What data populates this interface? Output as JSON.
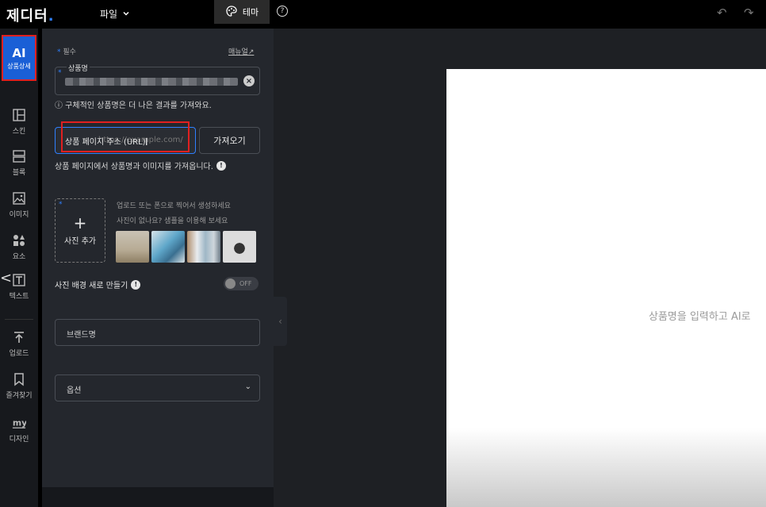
{
  "app": {
    "logo": "제디터",
    "file_menu": "파일",
    "theme_label": "테마",
    "help_glyph": "?",
    "undo_glyph": "↶",
    "redo_glyph": "↷"
  },
  "rail": {
    "ai": {
      "title": "AI",
      "label": "상품상세"
    },
    "items": [
      {
        "label": "스킨",
        "icon": "layout-icon"
      },
      {
        "label": "블록",
        "icon": "block-icon"
      },
      {
        "label": "이미지",
        "icon": "image-icon"
      },
      {
        "label": "요소",
        "icon": "shapes-icon"
      },
      {
        "label": "텍스트",
        "icon": "text-icon"
      },
      {
        "label": "업로드",
        "icon": "upload-icon"
      },
      {
        "label": "즐겨찾기",
        "icon": "bookmark-icon"
      },
      {
        "label": "디자인",
        "icon": "my-design-icon"
      }
    ],
    "collapse_glyph": "<"
  },
  "panel": {
    "required_note": "필수",
    "manual_link": "매뉴얼↗",
    "product_name": {
      "label": "상품명",
      "hint": "ⓘ 구체적인 상품명은 더 나은 결과를 가져와요."
    },
    "url": {
      "label": "상품 페이지 주소 (URL)",
      "placeholder": "https://example.com/",
      "fetch_button": "가져오기",
      "hint": "상품 페이지에서 상품명과 이미지를 가져옵니다."
    },
    "photo": {
      "add_label": "사진 추가",
      "upload_hint": "업로드 또는 폰으로 찍어서 생성하세요",
      "sample_hint": "사진이 없나요? 샘플을 이용해 보세요"
    },
    "bg_toggle": {
      "label": "사진 배경 새로 만들기",
      "state": "OFF"
    },
    "brand_placeholder": "브랜드명",
    "option_label": "옵션"
  },
  "canvas": {
    "placeholder": "상품명을 입력하고 AI로"
  },
  "colors": {
    "accent": "#2f80ff",
    "highlight": "#e02020",
    "panel_bg": "#24272d"
  }
}
